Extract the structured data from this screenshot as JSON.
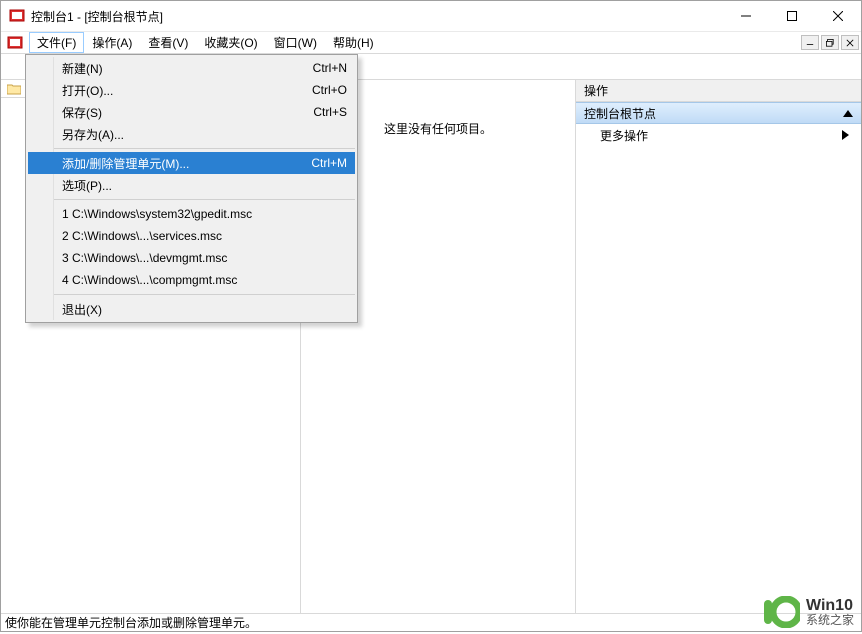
{
  "titlebar": {
    "title": "控制台1 - [控制台根节点]"
  },
  "menubar": {
    "items": [
      "文件(F)",
      "操作(A)",
      "查看(V)",
      "收藏夹(O)",
      "窗口(W)",
      "帮助(H)"
    ]
  },
  "dropdown": {
    "items": [
      {
        "label": "新建(N)",
        "accel": "Ctrl+N"
      },
      {
        "label": "打开(O)...",
        "accel": "Ctrl+O"
      },
      {
        "label": "保存(S)",
        "accel": "Ctrl+S"
      },
      {
        "label": "另存为(A)...",
        "accel": ""
      },
      {
        "sep": true
      },
      {
        "label": "添加/删除管理单元(M)...",
        "accel": "Ctrl+M",
        "selected": true
      },
      {
        "label": "选项(P)...",
        "accel": ""
      },
      {
        "sep": true
      },
      {
        "label": "1 C:\\Windows\\system32\\gpedit.msc",
        "accel": ""
      },
      {
        "label": "2 C:\\Windows\\...\\services.msc",
        "accel": ""
      },
      {
        "label": "3 C:\\Windows\\...\\devmgmt.msc",
        "accel": ""
      },
      {
        "label": "4 C:\\Windows\\...\\compmgmt.msc",
        "accel": ""
      },
      {
        "sep": true
      },
      {
        "label": "退出(X)",
        "accel": ""
      }
    ]
  },
  "mid_pane": {
    "empty_text": "这里没有任何项目。"
  },
  "right_pane": {
    "header": "操作",
    "section": "控制台根节点",
    "more": "更多操作"
  },
  "statusbar": {
    "text": "使你能在管理单元控制台添加或删除管理单元。"
  },
  "watermark": {
    "line1": "Win10",
    "line2": "系统之家"
  }
}
